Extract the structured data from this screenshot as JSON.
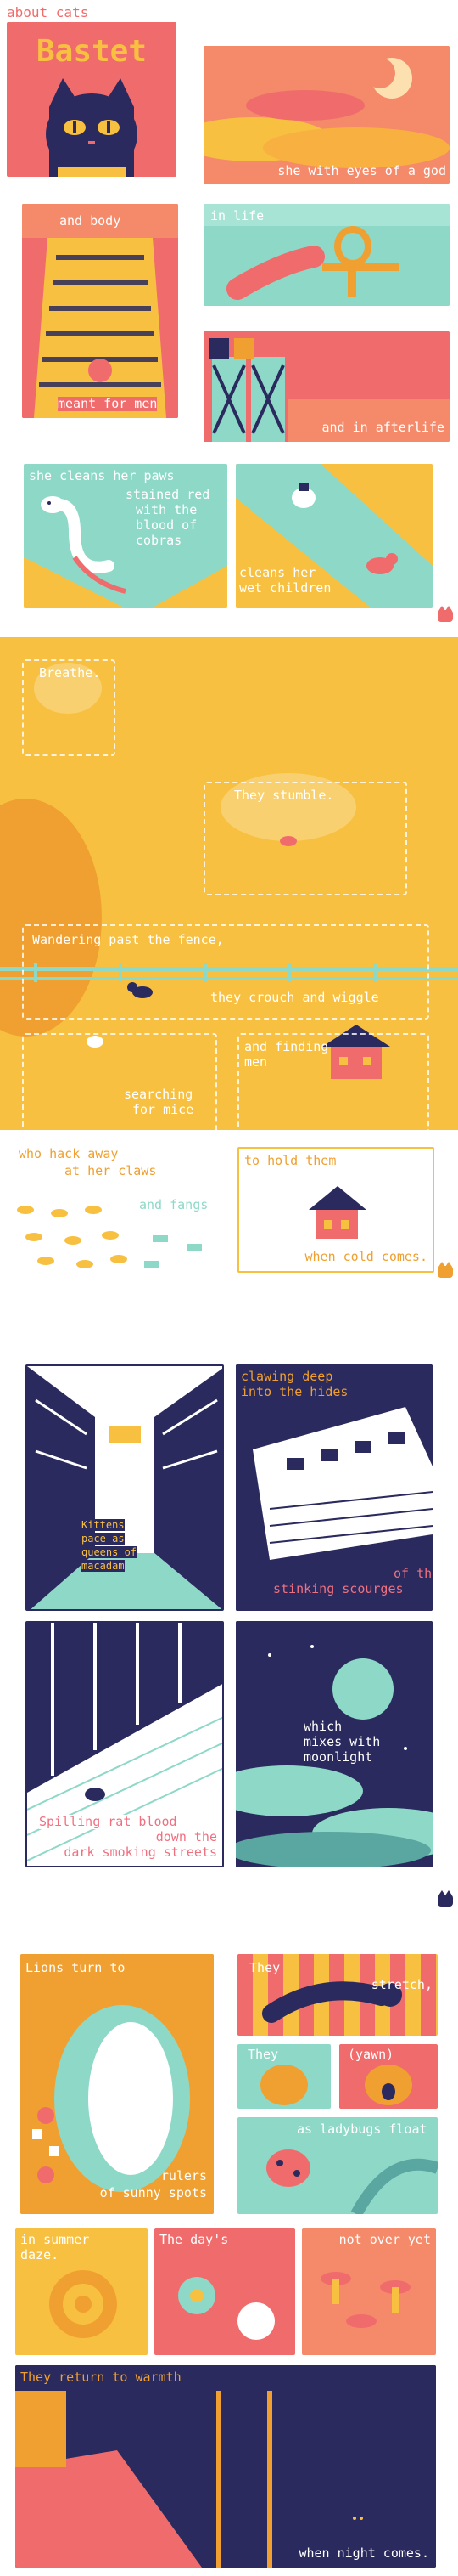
{
  "s1": {
    "header": "about cats",
    "title": "Bastet",
    "c1": "she with eyes of a god",
    "c2": "and body",
    "c3": "meant for men",
    "c4": "in life",
    "c5": "and in afterlife",
    "c6a": "she cleans her paws",
    "c6b": "stained red",
    "c6c": "with the",
    "c6d": "blood of",
    "c6e": "cobras",
    "c7a": "cleans her",
    "c7b": "wet children"
  },
  "s2": {
    "c1": "Breathe.",
    "c2": "They stumble.",
    "c3": "Wandering past the fence,",
    "c4": "they crouch and wiggle",
    "c5a": "searching",
    "c5b": "for mice",
    "c6a": "and finding",
    "c6b": "men",
    "c7a": "who hack away",
    "c7b": "at her claws",
    "c7c": "and fangs",
    "c8a": "to hold them",
    "c8b": "when cold comes."
  },
  "s3": {
    "c1a": "Kittens",
    "c1b": "pace as",
    "c1c": "queens of",
    "c1d": "macadam",
    "c2a": "clawing deep",
    "c2b": "into the hides",
    "c3a": "of the",
    "c3b": "stinking scourges",
    "c4a": "Spilling rat blood",
    "c4b": "down the",
    "c4c": "dark smoking streets",
    "c5a": "which",
    "c5b": "mixes with",
    "c5c": "moonlight"
  },
  "s4": {
    "c1": "Lions turn to",
    "c2a": "rulers",
    "c2b": "of sunny spots",
    "c3a": "They",
    "c3b": "stretch,",
    "c4a": "They",
    "c4b": "(yawn)",
    "c5": "as ladybugs float",
    "c6a": "in summer",
    "c6b": "daze.",
    "c7": "The day's",
    "c8": "not over yet",
    "c9a": "They return to warmth",
    "c9b": "when night comes."
  },
  "colors": {
    "coral": "#f06c6c",
    "yellow": "#f8c040",
    "teal": "#8ed8c8",
    "navy": "#2a2a5e",
    "orange": "#f0a030"
  },
  "icons": [
    "cat-badge-icon",
    "cat-badge-icon",
    "cat-badge-icon",
    "cat-badge-icon"
  ]
}
